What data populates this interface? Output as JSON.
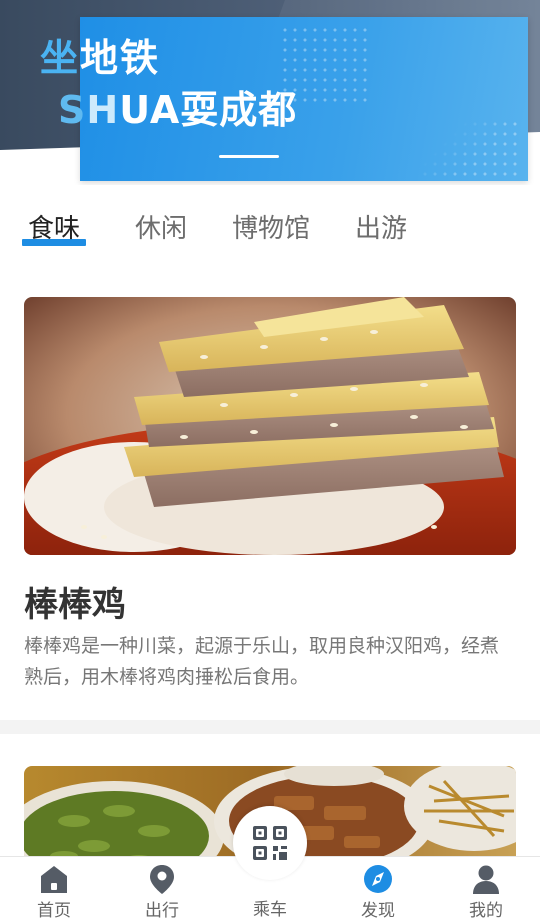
{
  "banner": {
    "title_first_char": "坐",
    "title_rest": "地铁",
    "subtitle_s": "S",
    "subtitle_h": "H",
    "subtitle_rest": "UA耍成都",
    "accent_color": "#1f8fe6"
  },
  "tabs": [
    {
      "label": "食味",
      "active": true
    },
    {
      "label": "休闲",
      "active": false
    },
    {
      "label": "博物馆",
      "active": false
    },
    {
      "label": "出游",
      "active": false
    }
  ],
  "cards": [
    {
      "image_icon": "bangbang-chicken-photo",
      "title": "棒棒鸡",
      "description": "棒棒鸡是一种川菜，起源于乐山，取用良种汉阳鸡，经煮熟后，用木棒将鸡肉捶松后食用。"
    },
    {
      "image_icon": "snack-platter-photo"
    }
  ],
  "bottom_nav": {
    "items": [
      {
        "label": "首页",
        "icon": "home-icon",
        "active": false
      },
      {
        "label": "出行",
        "icon": "location-pin-icon",
        "active": false
      },
      {
        "label": "乘车",
        "icon": "qr-code-icon",
        "active": false
      },
      {
        "label": "发现",
        "icon": "compass-icon",
        "active": true
      },
      {
        "label": "我的",
        "icon": "user-icon",
        "active": false
      }
    ],
    "active_color": "#1e8de3"
  }
}
